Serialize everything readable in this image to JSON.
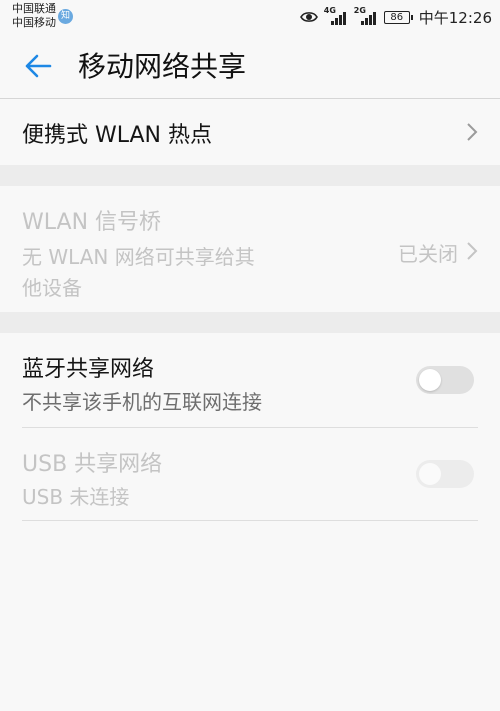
{
  "status_bar": {
    "carrier1": "中国联通",
    "carrier2": "中国移动",
    "badge": "知",
    "signal1_tech": "4G",
    "signal2_tech": "2G",
    "battery": "86",
    "time": "中午12:26",
    "eye_icon": "eye-icon"
  },
  "header": {
    "back_icon": "arrow-left-icon",
    "title": "移动网络共享"
  },
  "items": {
    "hotspot": {
      "label": "便携式 WLAN 热点"
    },
    "bridge": {
      "label": "WLAN 信号桥",
      "subtitle_line1": "无 WLAN 网络可共享给其",
      "subtitle_line2": "他设备",
      "value": "已关闭"
    },
    "bluetooth": {
      "label": "蓝牙共享网络",
      "subtitle": "不共享该手机的互联网连接",
      "enabled": false
    },
    "usb": {
      "label": "USB 共享网络",
      "subtitle": "USB 未连接",
      "enabled": false
    }
  },
  "colors": {
    "accent": "#1e88e5",
    "background": "#f8f8f8",
    "section_gap": "#ececec",
    "disabled_text": "#c4c4c4"
  }
}
